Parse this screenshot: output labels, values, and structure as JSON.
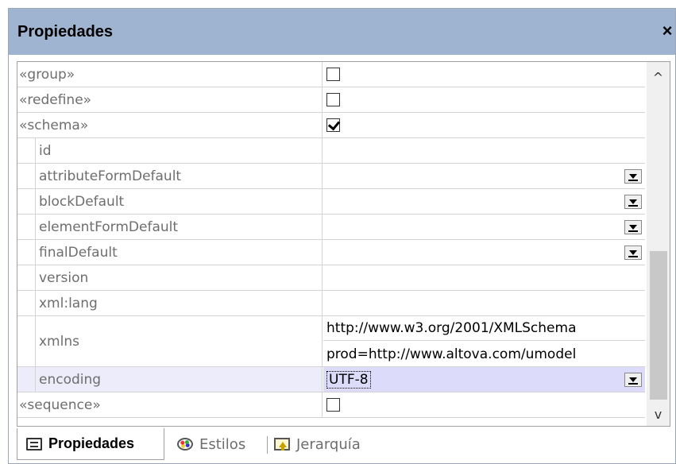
{
  "panel": {
    "title": "Propiedades",
    "close_glyph": "×"
  },
  "rows": [
    {
      "label": "«group»",
      "type": "checkbox",
      "checked": false
    },
    {
      "label": "«redefine»",
      "type": "checkbox",
      "checked": false
    },
    {
      "label": "«schema»",
      "type": "checkbox",
      "checked": true
    },
    {
      "label": "id",
      "type": "text",
      "value": ""
    },
    {
      "label": "attributeFormDefault",
      "type": "dropdown",
      "value": ""
    },
    {
      "label": "blockDefault",
      "type": "dropdown",
      "value": ""
    },
    {
      "label": "elementFormDefault",
      "type": "dropdown",
      "value": ""
    },
    {
      "label": "finalDefault",
      "type": "dropdown",
      "value": ""
    },
    {
      "label": "version",
      "type": "text",
      "value": ""
    },
    {
      "label": "xml:lang",
      "type": "text",
      "value": ""
    },
    {
      "label": "xmlns",
      "type": "multi",
      "values": [
        "http://www.w3.org/2001/XMLSchema",
        "prod=http://www.altova.com/umodel"
      ]
    },
    {
      "label": "encoding",
      "type": "dropdown",
      "value": "UTF-8",
      "selected": true
    },
    {
      "label": "«sequence»",
      "type": "checkbox",
      "checked": false
    }
  ],
  "scrollbar": {
    "up_glyph": "^",
    "down_glyph": "v"
  },
  "tabs": [
    {
      "label": "Propiedades",
      "icon": "properties-icon",
      "active": true
    },
    {
      "label": "Estilos",
      "icon": "palette-icon",
      "active": false
    },
    {
      "label": "Jerarquía",
      "icon": "hierarchy-icon",
      "active": false
    }
  ],
  "colors": {
    "titlebar": "#9fb4d0",
    "selected_row": "#dcdcfa"
  }
}
